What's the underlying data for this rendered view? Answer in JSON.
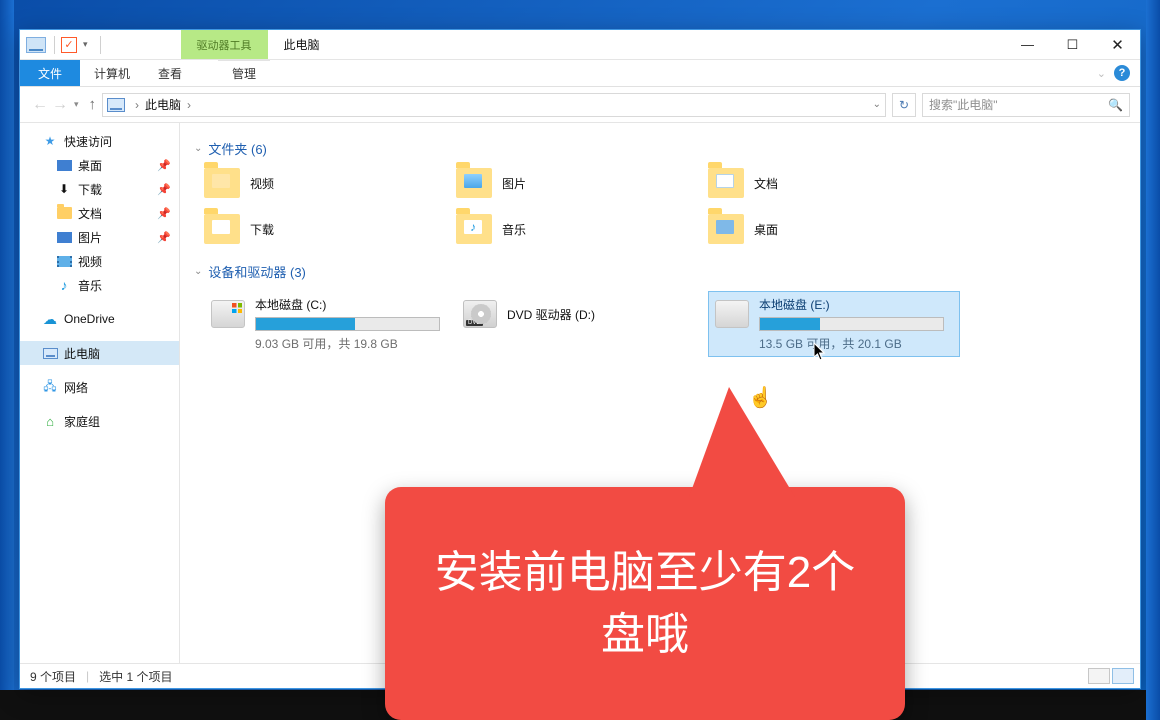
{
  "title": "此电脑",
  "ribbon": {
    "context_tab_top": "驱动器工具",
    "file": "文件",
    "tabs": [
      "计算机",
      "查看"
    ],
    "manage": "管理"
  },
  "nav": {
    "breadcrumb_root": "此电脑",
    "search_placeholder": "搜索\"此电脑\""
  },
  "navpane": {
    "quick_access": "快速访问",
    "desktop": "桌面",
    "downloads": "下载",
    "documents": "文档",
    "pictures": "图片",
    "videos": "视频",
    "music": "音乐",
    "onedrive": "OneDrive",
    "this_pc": "此电脑",
    "network": "网络",
    "homegroup": "家庭组"
  },
  "groups": {
    "folders_label": "文件夹 (6)",
    "devices_label": "设备和驱动器 (3)"
  },
  "folders": [
    {
      "label": "视频"
    },
    {
      "label": "图片"
    },
    {
      "label": "文档"
    },
    {
      "label": "下载"
    },
    {
      "label": "音乐"
    },
    {
      "label": "桌面"
    }
  ],
  "drives": {
    "c": {
      "title": "本地磁盘 (C:)",
      "sub": "9.03 GB 可用，共 19.8 GB",
      "fill_pct": 54
    },
    "d": {
      "title": "DVD 驱动器 (D:)"
    },
    "e": {
      "title": "本地磁盘 (E:)",
      "sub": "13.5 GB 可用，共 20.1 GB",
      "fill_pct": 33
    }
  },
  "status": {
    "items": "9 个项目",
    "selected": "选中 1 个项目"
  },
  "callout_text": "安装前电脑至少有2个盘哦"
}
